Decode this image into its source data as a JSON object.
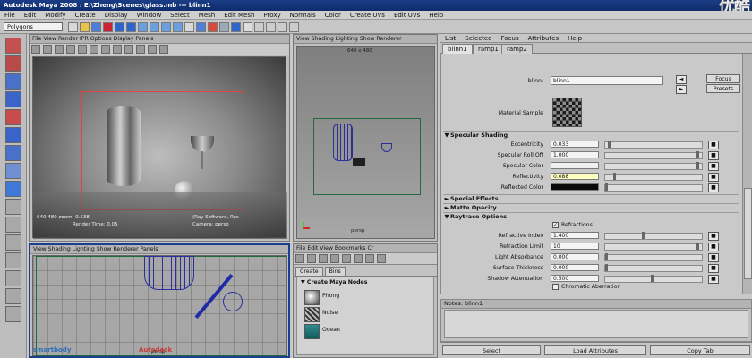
{
  "window": {
    "title": "Autodesk Maya 2008 : E:\\Zheng\\Scenes\\glass.mb   ---   blinn1"
  },
  "watermark": "优酷",
  "menu": [
    "File",
    "Edit",
    "Modify",
    "Create",
    "Display",
    "Window",
    "Select",
    "Mesh",
    "Edit Mesh",
    "Proxy",
    "Normals",
    "Color",
    "Create UVs",
    "Edit UVs",
    "Help"
  ],
  "toolbar": {
    "menu_set": "Polygons"
  },
  "panels": {
    "persp": {
      "menu": "File  View  Render  IPR  Options  Display  Panels",
      "status_left": "640  480  zoom: 0.538",
      "status_right": "(Ray Software, Res",
      "render_time": "Render Time: 0.05",
      "camera": "Camera: persp"
    },
    "top_right": {
      "menu": "View  Shading  Lighting  Show  Renderer",
      "resolution": "640 x 480",
      "label": "persp"
    },
    "bottom_left": {
      "menu": "View  Shading  Lighting  Show  Renderer  Panels",
      "label": "persp",
      "logo_left": "smartbody",
      "logo_right": "Autodesk"
    },
    "hypershade": {
      "menu": "File  Edit  View  Bookmarks  Cr",
      "tabs": [
        "Create",
        "Bins"
      ],
      "section": "Create Maya Nodes",
      "nodes": [
        "Phong",
        "Noise",
        "Ocean"
      ]
    }
  },
  "attribute_editor": {
    "menu": [
      "List",
      "Selected",
      "Focus",
      "Attributes",
      "Help"
    ],
    "tabs": [
      "blinn1",
      "ramp1",
      "ramp2"
    ],
    "blinn_label": "blinn:",
    "blinn_value": "blinn1",
    "focus_button": "Focus",
    "presets_button": "Presets",
    "material_sample_label": "Material Sample",
    "sections": {
      "specular": "Specular Shading",
      "special": "Special Effects",
      "matte": "Matte Opacity",
      "raytrace": "Raytrace Options"
    },
    "specular_rows": [
      {
        "label": "Eccentricity",
        "value": "0.033",
        "slider": 0.03
      },
      {
        "label": "Specular Roll Off",
        "value": "1.000",
        "slider": 1.0
      },
      {
        "label": "Specular Color",
        "value": "",
        "slider": 1.0
      },
      {
        "label": "Reflectivity",
        "value": "0.088",
        "slider": 0.09
      },
      {
        "label": "Reflected Color",
        "value": "",
        "slider": 0.0
      }
    ],
    "refractions_label": "Refractions",
    "raytrace_rows": [
      {
        "label": "Refractive Index",
        "value": "1.400",
        "slider": 0.4
      },
      {
        "label": "Refraction Limit",
        "value": "10",
        "slider": 1.0
      },
      {
        "label": "Light Absorbance",
        "value": "0.000",
        "slider": 0.0
      },
      {
        "label": "Surface Thickness",
        "value": "0.000",
        "slider": 0.0
      },
      {
        "label": "Shadow Attenuation",
        "value": "0.500",
        "slider": 0.5
      }
    ],
    "chromatic_label": "Chromatic Aberration",
    "notes_label": "Notes: blinn1",
    "buttons": [
      "Select",
      "Load Attributes",
      "Copy Tab"
    ]
  },
  "colors": {
    "accent_title": "#1b3d86",
    "wire": "#2a2f9c",
    "render_gate": "#e04444",
    "reflectivity_field": "#fffec2",
    "reflected_color": "#0a0a0a"
  }
}
